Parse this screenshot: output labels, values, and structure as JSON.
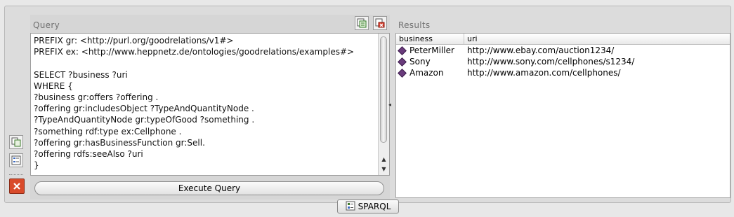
{
  "query_panel": {
    "title": "Query",
    "query_lines": [
      "PREFIX gr: <http://purl.org/goodrelations/v1#>",
      "PREFIX ex: <http://www.heppnetz.de/ontologies/goodrelations/examples#>",
      "",
      "SELECT ?business ?uri",
      "WHERE {",
      "?business gr:offers ?offering .",
      "?offering gr:includesObject ?TypeAndQuantityNode .",
      "?TypeAndQuantityNode gr:typeOfGood ?something .",
      "?something rdf:type ex:Cellphone .",
      "?offering gr:hasBusinessFunction gr:Sell.",
      "?offering rdfs:seeAlso ?uri",
      "}"
    ],
    "execute_label": "Execute Query",
    "toolbar_icons": [
      "new-query-icon",
      "clear-query-icon"
    ]
  },
  "results_panel": {
    "title": "Results",
    "columns": [
      "business",
      "uri"
    ],
    "rows": [
      {
        "business": "PeterMiller",
        "uri": "http://www.ebay.com/auction1234/"
      },
      {
        "business": "Sony",
        "uri": "http://www.sony.com/cellphones/s1234/"
      },
      {
        "business": "Amazon",
        "uri": "http://www.amazon.com/cellphones/"
      }
    ]
  },
  "side_toolbar_icons": [
    "copy-view-icon",
    "list-view-icon",
    "close-icon"
  ],
  "bottom_tab": {
    "label": "SPARQL"
  },
  "colors": {
    "individual_diamond": "#6a3b7c",
    "close_red": "#d94b2b"
  }
}
